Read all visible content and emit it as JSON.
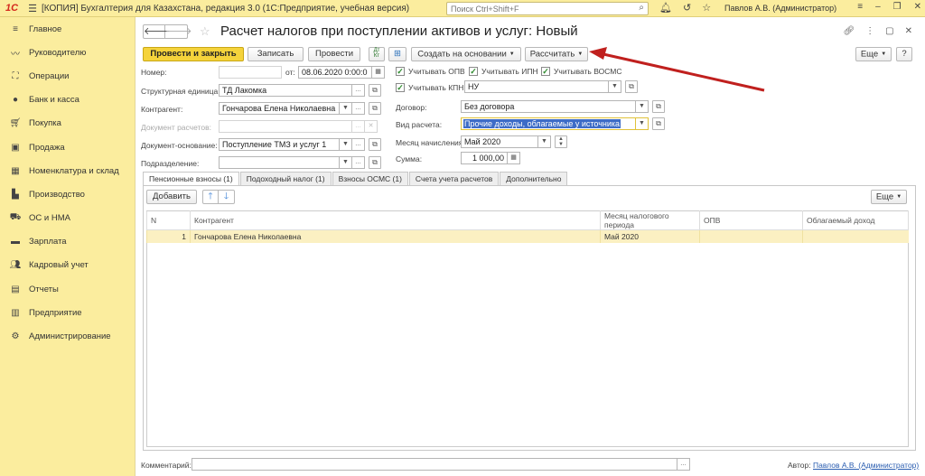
{
  "app": {
    "title": "[КОПИЯ] Бухгалтерия для Казахстана, редакция 3.0  (1С:Предприятие, учебная версия)",
    "search_placeholder": "Поиск Ctrl+Shift+F",
    "user": "Павлов А.В. (Администратор)"
  },
  "sidebar": {
    "items": [
      {
        "label": "Главное",
        "icon": "menu-icon"
      },
      {
        "label": "Руководителю",
        "icon": "chart-line-icon"
      },
      {
        "label": "Операции",
        "icon": "operations-icon"
      },
      {
        "label": "Банк и касса",
        "icon": "bank-icon"
      },
      {
        "label": "Покупка",
        "icon": "cart-icon"
      },
      {
        "label": "Продажа",
        "icon": "bag-icon"
      },
      {
        "label": "Номенклатура и склад",
        "icon": "grid-icon"
      },
      {
        "label": "Производство",
        "icon": "factory-icon"
      },
      {
        "label": "ОС и НМА",
        "icon": "car-icon"
      },
      {
        "label": "Зарплата",
        "icon": "money-icon"
      },
      {
        "label": "Кадровый учет",
        "icon": "people-icon"
      },
      {
        "label": "Отчеты",
        "icon": "reports-icon"
      },
      {
        "label": "Предприятие",
        "icon": "building-icon"
      },
      {
        "label": "Администрирование",
        "icon": "gear-icon"
      }
    ]
  },
  "document": {
    "title": "Расчет налогов при поступлении активов и услуг: Новый"
  },
  "toolbar": {
    "post_close": "Провести и закрыть",
    "save": "Записать",
    "post": "Провести",
    "create_based": "Создать на основании",
    "calculate": "Рассчитать",
    "more": "Еще",
    "help": "?"
  },
  "form": {
    "number_label": "Номер:",
    "number_value": "",
    "from_label": "от:",
    "date_value": "08.06.2020  0:00:0",
    "unit_label": "Структурная единица:",
    "unit_value": "ТД Лакомка",
    "counterparty_label": "Контрагент:",
    "counterparty_value": "Гончарова Елена Николаевна",
    "settlement_doc_label": "Документ расчетов:",
    "settlement_doc_value": "",
    "base_doc_label": "Документ-основание:",
    "base_doc_value": "Поступление ТМЗ и услуг 1",
    "division_label": "Подразделение:",
    "division_value": "",
    "cb_opv": "Учитывать ОПВ",
    "cb_ipn": "Учитывать ИПН",
    "cb_vosms": "Учитывать ВОСМС",
    "cb_kpn": "Учитывать КПН",
    "kpn_value": "НУ",
    "contract_label": "Договор:",
    "contract_value": "Без договора",
    "calc_type_label": "Вид расчета:",
    "calc_type_value": "Прочие доходы, облагаемые у источника",
    "month_label": "Месяц начисления:",
    "month_value": "Май 2020",
    "sum_label": "Сумма:",
    "sum_value": "1 000,00"
  },
  "tabs": [
    {
      "label": "Пенсионные взносы (1)"
    },
    {
      "label": "Подоходный налог (1)"
    },
    {
      "label": "Взносы ОСМС (1)"
    },
    {
      "label": "Счета учета расчетов"
    },
    {
      "label": "Дополнительно"
    }
  ],
  "table": {
    "add_label": "Добавить",
    "more_label": "Еще",
    "columns": [
      "N",
      "Контрагент",
      "Месяц налогового периода",
      "ОПВ",
      "Облагаемый доход"
    ],
    "rows": [
      [
        "1",
        "Гончарова Елена Николаевна",
        "Май 2020",
        "",
        ""
      ]
    ]
  },
  "footer": {
    "comment_label": "Комментарий:",
    "comment_value": "",
    "author_label": "Автор:",
    "author_value": "Павлов А.В. (Администратор)"
  },
  "colors": {
    "sidebar_bg": "#fbed9e",
    "primary_button": "#f5d33b",
    "selected_row": "#fbf0c2",
    "annotation_arrow": "#c0201e"
  }
}
